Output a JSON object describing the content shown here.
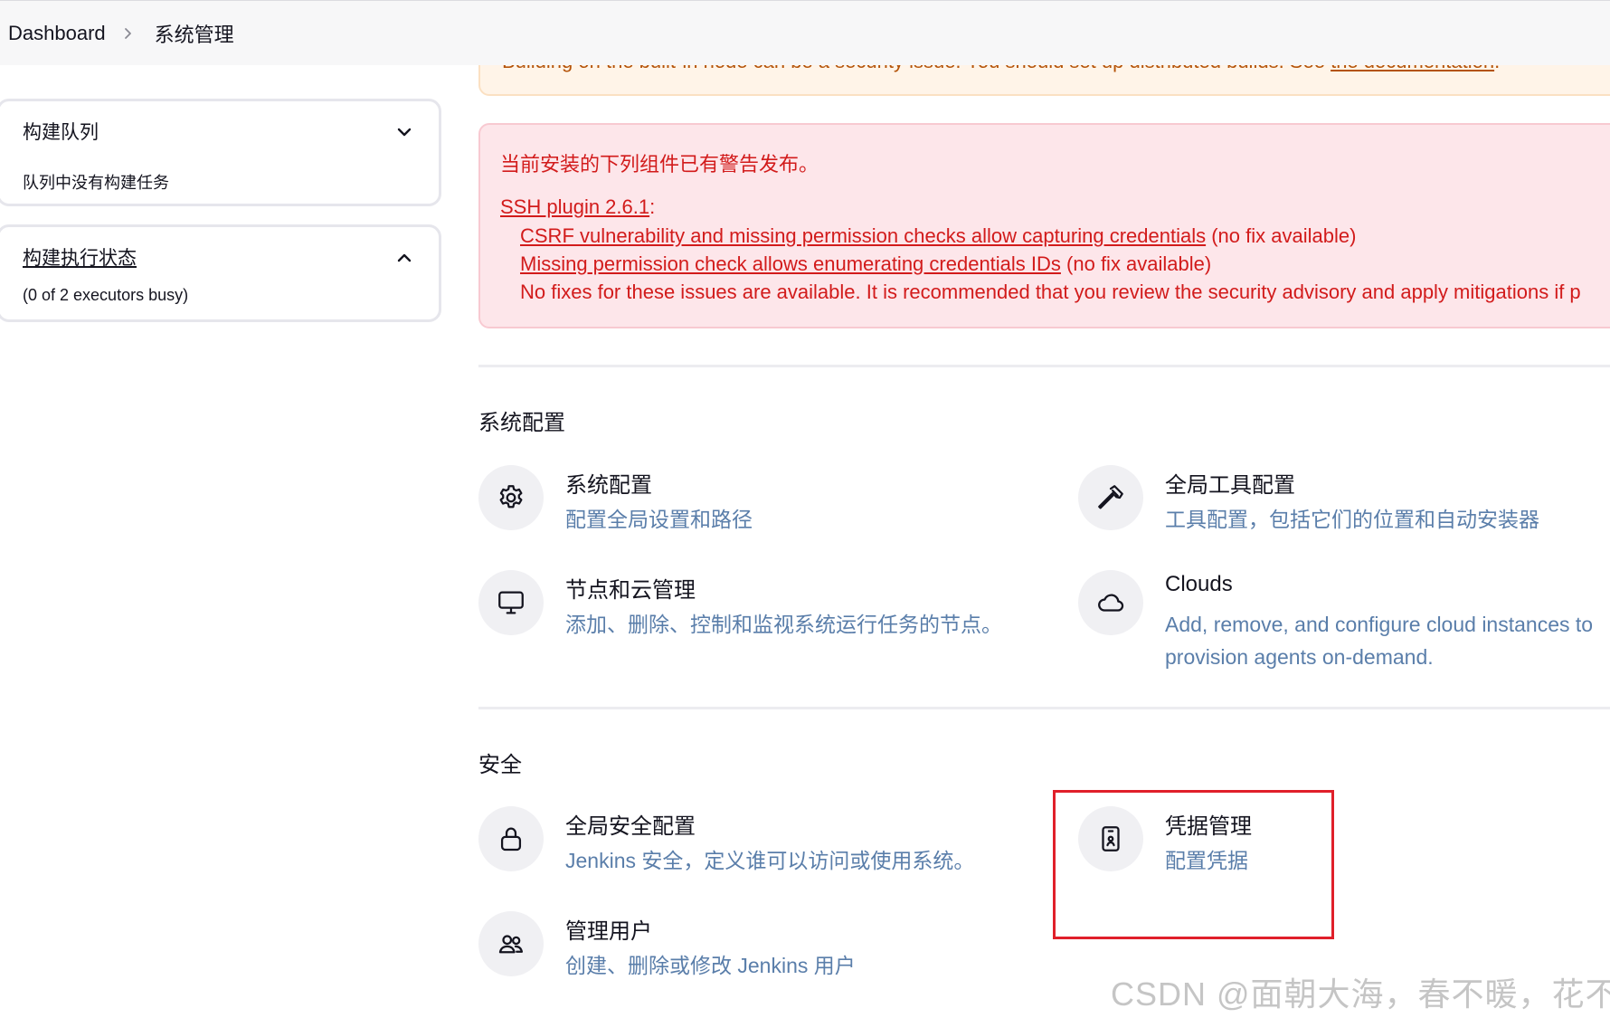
{
  "breadcrumb": {
    "home": "Dashboard",
    "current": "系统管理"
  },
  "build_queue": {
    "title": "构建队列",
    "empty_text": "队列中没有构建任务"
  },
  "executor_status": {
    "title": "构建执行状态",
    "summary": "(0 of 2 executors busy)"
  },
  "notice_builtin": {
    "text": "Building on the built-in node can be a security issue. You should set up distributed builds. See",
    "link": "the documentation",
    "suffix": "."
  },
  "security_warning": {
    "intro": "当前安装的下列组件已有警告发布。",
    "plugin_link": "SSH plugin 2.6.1",
    "plugin_suffix": ":",
    "issues": [
      {
        "link": "CSRF vulnerability and missing permission checks allow capturing credentials",
        "note": " (no fix available)"
      },
      {
        "link": "Missing permission check allows enumerating credentials IDs",
        "note": " (no fix available)"
      }
    ],
    "advice": "No fixes for these issues are available. It is recommended that you review the security advisory and apply mitigations if p"
  },
  "sections": {
    "system_config": {
      "title": "系统配置",
      "items": [
        {
          "title": "系统配置",
          "desc": "配置全局设置和路径",
          "icon": "gear-icon"
        },
        {
          "title": "全局工具配置",
          "desc": "工具配置，包括它们的位置和自动安装器",
          "icon": "hammer-icon"
        },
        {
          "title": "节点和云管理",
          "desc": "添加、删除、控制和监视系统运行任务的节点。",
          "icon": "monitor-icon"
        },
        {
          "title": "Clouds",
          "desc_line1": "Add, remove, and configure cloud instances to",
          "desc_line2": "provision agents on-demand.",
          "icon": "cloud-icon"
        }
      ]
    },
    "security": {
      "title": "安全",
      "items": [
        {
          "title": "全局安全配置",
          "desc": "Jenkins 安全，定义谁可以访问或使用系统。",
          "icon": "lock-icon"
        },
        {
          "title": "凭据管理",
          "desc": "配置凭据",
          "icon": "id-badge-icon"
        },
        {
          "title": "管理用户",
          "desc": "创建、删除或修改 Jenkins 用户",
          "icon": "users-icon"
        }
      ]
    }
  },
  "watermark": "CSDN @面朝大海，春不暖，花不开",
  "colors": {
    "highlight": "#e0202a",
    "warning_text": "#d21b1b",
    "description_text": "#5a7eaa",
    "notice_text": "#b45309"
  }
}
